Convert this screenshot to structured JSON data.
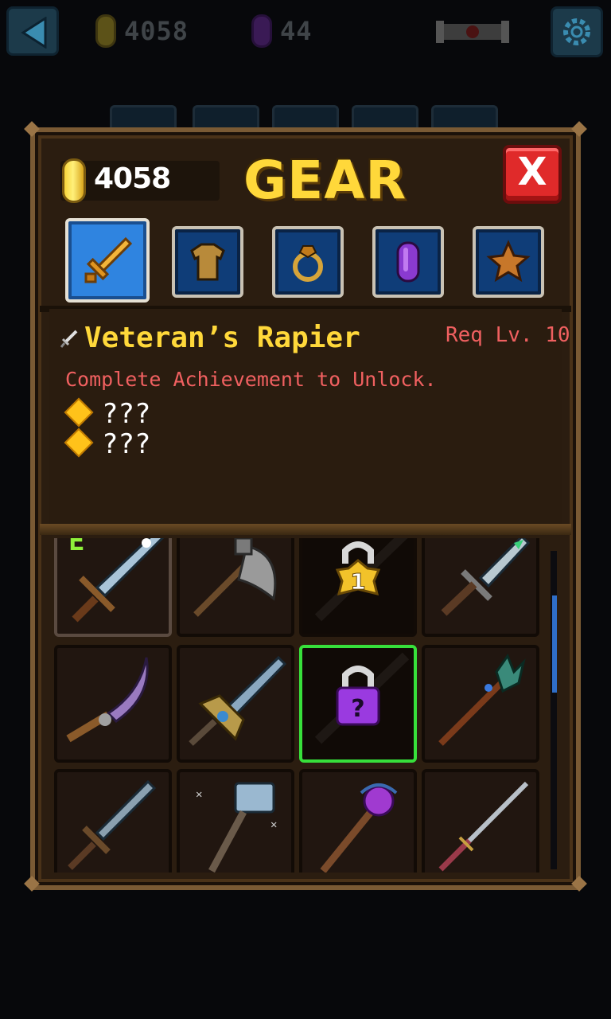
{
  "hud": {
    "gold": "4058",
    "gems": "44"
  },
  "panel": {
    "title": "GEAR",
    "coins": "4058",
    "close_label": "X"
  },
  "categories": [
    {
      "name": "weapons",
      "icon": "sword-icon",
      "active": true
    },
    {
      "name": "armor",
      "icon": "armor-icon",
      "active": false
    },
    {
      "name": "rings",
      "icon": "ring-icon",
      "active": false
    },
    {
      "name": "gems",
      "icon": "gem-icon",
      "active": false
    },
    {
      "name": "stars",
      "icon": "star-icon",
      "active": false
    }
  ],
  "item": {
    "name": "Veteran’s Rapier",
    "req": "Req Lv. 10",
    "description": "Complete Achievement to Unlock.",
    "bonuses": [
      "???",
      "???"
    ]
  },
  "grid": {
    "equipped_badge": "E",
    "lock_level": "1",
    "lock_mystery": "?",
    "items": [
      {
        "icon": "sword-icon",
        "state": "equipped"
      },
      {
        "icon": "axe-icon",
        "state": "normal"
      },
      {
        "icon": "locked-sword-icon",
        "state": "locked-level"
      },
      {
        "icon": "dagger-icon",
        "state": "normal"
      },
      {
        "icon": "curved-dagger-icon",
        "state": "normal"
      },
      {
        "icon": "ornate-sword-icon",
        "state": "normal"
      },
      {
        "icon": "locked-rapier-icon",
        "state": "selected-locked"
      },
      {
        "icon": "staff-icon",
        "state": "normal"
      },
      {
        "icon": "broadsword-icon",
        "state": "normal"
      },
      {
        "icon": "hammer-icon",
        "state": "normal"
      },
      {
        "icon": "orb-staff-icon",
        "state": "normal"
      },
      {
        "icon": "katana-icon",
        "state": "normal"
      }
    ]
  },
  "colors": {
    "title": "#ffd83a",
    "warning": "#f06060",
    "selected": "#37e03b",
    "panel": "#2b1d10"
  }
}
